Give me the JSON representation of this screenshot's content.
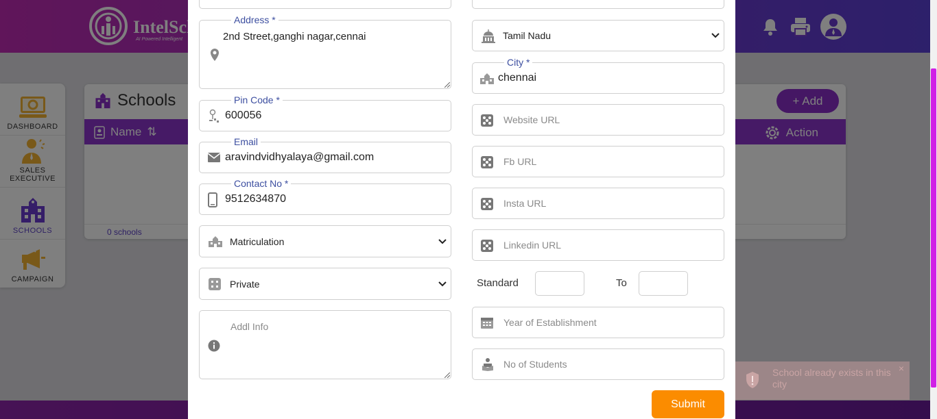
{
  "app": {
    "brand_name": "IntelSch",
    "brand_tagline": "AI Powered Intelligent",
    "colors": {
      "header_start": "#c02bb4",
      "header_end": "#5a40d6",
      "accent": "#8c34cc",
      "submit": "#fb8c00"
    }
  },
  "header": {
    "icons": [
      "bell-icon",
      "printer-icon",
      "user-avatar-icon"
    ]
  },
  "sidebar": {
    "items": [
      {
        "label": "DASHBOARD",
        "icon": "dashboard-icon"
      },
      {
        "label": "SALES EXECUTIVE",
        "icon": "sales-executive-icon"
      },
      {
        "label": "SCHOOLS",
        "icon": "school-icon",
        "active": true
      },
      {
        "label": "CAMPAIGN",
        "icon": "megaphone-icon"
      }
    ]
  },
  "schools_card": {
    "title": "Schools",
    "add_label": "+ Add",
    "col_name": "Name",
    "col_action": "Action",
    "footer_count": "0 schools"
  },
  "form": {
    "address": {
      "label": "Address *",
      "value": "2nd Street,ganghi nagar,cennai"
    },
    "pincode": {
      "label": "Pin Code *",
      "value": "600056"
    },
    "email": {
      "label": "Email",
      "value": "aravindvidhyalaya@gmail.com"
    },
    "contact": {
      "label": "Contact No *",
      "value": "9512634870"
    },
    "board": {
      "selected": "Matriculation"
    },
    "type": {
      "selected": "Private"
    },
    "addl_info": {
      "placeholder": "Addl Info"
    },
    "state": {
      "selected": "Tamil Nadu"
    },
    "city": {
      "label": "City *",
      "value": "chennai"
    },
    "website": {
      "placeholder": "Website URL"
    },
    "fb": {
      "placeholder": "Fb URL"
    },
    "insta": {
      "placeholder": "Insta URL"
    },
    "linkedin": {
      "placeholder": "Linkedin URL"
    },
    "standard": {
      "label": "Standard",
      "to_label": "To"
    },
    "year": {
      "placeholder": "Year of Establishment"
    },
    "students": {
      "placeholder": "No of Students"
    },
    "submit_label": "Submit"
  },
  "toast": {
    "message": "School already exists in this city",
    "close": "×"
  }
}
